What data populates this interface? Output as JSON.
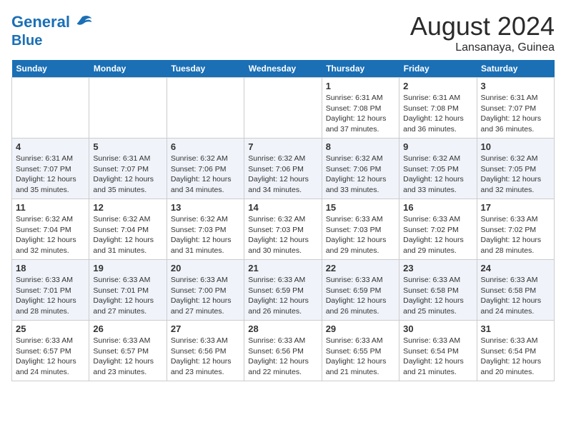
{
  "logo": {
    "line1": "General",
    "line2": "Blue"
  },
  "title": "August 2024",
  "location": "Lansanaya, Guinea",
  "days_of_week": [
    "Sunday",
    "Monday",
    "Tuesday",
    "Wednesday",
    "Thursday",
    "Friday",
    "Saturday"
  ],
  "weeks": [
    [
      {
        "day": "",
        "info": ""
      },
      {
        "day": "",
        "info": ""
      },
      {
        "day": "",
        "info": ""
      },
      {
        "day": "",
        "info": ""
      },
      {
        "day": "1",
        "info": "Sunrise: 6:31 AM\nSunset: 7:08 PM\nDaylight: 12 hours\nand 37 minutes."
      },
      {
        "day": "2",
        "info": "Sunrise: 6:31 AM\nSunset: 7:08 PM\nDaylight: 12 hours\nand 36 minutes."
      },
      {
        "day": "3",
        "info": "Sunrise: 6:31 AM\nSunset: 7:07 PM\nDaylight: 12 hours\nand 36 minutes."
      }
    ],
    [
      {
        "day": "4",
        "info": "Sunrise: 6:31 AM\nSunset: 7:07 PM\nDaylight: 12 hours\nand 35 minutes."
      },
      {
        "day": "5",
        "info": "Sunrise: 6:31 AM\nSunset: 7:07 PM\nDaylight: 12 hours\nand 35 minutes."
      },
      {
        "day": "6",
        "info": "Sunrise: 6:32 AM\nSunset: 7:06 PM\nDaylight: 12 hours\nand 34 minutes."
      },
      {
        "day": "7",
        "info": "Sunrise: 6:32 AM\nSunset: 7:06 PM\nDaylight: 12 hours\nand 34 minutes."
      },
      {
        "day": "8",
        "info": "Sunrise: 6:32 AM\nSunset: 7:06 PM\nDaylight: 12 hours\nand 33 minutes."
      },
      {
        "day": "9",
        "info": "Sunrise: 6:32 AM\nSunset: 7:05 PM\nDaylight: 12 hours\nand 33 minutes."
      },
      {
        "day": "10",
        "info": "Sunrise: 6:32 AM\nSunset: 7:05 PM\nDaylight: 12 hours\nand 32 minutes."
      }
    ],
    [
      {
        "day": "11",
        "info": "Sunrise: 6:32 AM\nSunset: 7:04 PM\nDaylight: 12 hours\nand 32 minutes."
      },
      {
        "day": "12",
        "info": "Sunrise: 6:32 AM\nSunset: 7:04 PM\nDaylight: 12 hours\nand 31 minutes."
      },
      {
        "day": "13",
        "info": "Sunrise: 6:32 AM\nSunset: 7:03 PM\nDaylight: 12 hours\nand 31 minutes."
      },
      {
        "day": "14",
        "info": "Sunrise: 6:32 AM\nSunset: 7:03 PM\nDaylight: 12 hours\nand 30 minutes."
      },
      {
        "day": "15",
        "info": "Sunrise: 6:33 AM\nSunset: 7:03 PM\nDaylight: 12 hours\nand 29 minutes."
      },
      {
        "day": "16",
        "info": "Sunrise: 6:33 AM\nSunset: 7:02 PM\nDaylight: 12 hours\nand 29 minutes."
      },
      {
        "day": "17",
        "info": "Sunrise: 6:33 AM\nSunset: 7:02 PM\nDaylight: 12 hours\nand 28 minutes."
      }
    ],
    [
      {
        "day": "18",
        "info": "Sunrise: 6:33 AM\nSunset: 7:01 PM\nDaylight: 12 hours\nand 28 minutes."
      },
      {
        "day": "19",
        "info": "Sunrise: 6:33 AM\nSunset: 7:01 PM\nDaylight: 12 hours\nand 27 minutes."
      },
      {
        "day": "20",
        "info": "Sunrise: 6:33 AM\nSunset: 7:00 PM\nDaylight: 12 hours\nand 27 minutes."
      },
      {
        "day": "21",
        "info": "Sunrise: 6:33 AM\nSunset: 6:59 PM\nDaylight: 12 hours\nand 26 minutes."
      },
      {
        "day": "22",
        "info": "Sunrise: 6:33 AM\nSunset: 6:59 PM\nDaylight: 12 hours\nand 26 minutes."
      },
      {
        "day": "23",
        "info": "Sunrise: 6:33 AM\nSunset: 6:58 PM\nDaylight: 12 hours\nand 25 minutes."
      },
      {
        "day": "24",
        "info": "Sunrise: 6:33 AM\nSunset: 6:58 PM\nDaylight: 12 hours\nand 24 minutes."
      }
    ],
    [
      {
        "day": "25",
        "info": "Sunrise: 6:33 AM\nSunset: 6:57 PM\nDaylight: 12 hours\nand 24 minutes."
      },
      {
        "day": "26",
        "info": "Sunrise: 6:33 AM\nSunset: 6:57 PM\nDaylight: 12 hours\nand 23 minutes."
      },
      {
        "day": "27",
        "info": "Sunrise: 6:33 AM\nSunset: 6:56 PM\nDaylight: 12 hours\nand 23 minutes."
      },
      {
        "day": "28",
        "info": "Sunrise: 6:33 AM\nSunset: 6:56 PM\nDaylight: 12 hours\nand 22 minutes."
      },
      {
        "day": "29",
        "info": "Sunrise: 6:33 AM\nSunset: 6:55 PM\nDaylight: 12 hours\nand 21 minutes."
      },
      {
        "day": "30",
        "info": "Sunrise: 6:33 AM\nSunset: 6:54 PM\nDaylight: 12 hours\nand 21 minutes."
      },
      {
        "day": "31",
        "info": "Sunrise: 6:33 AM\nSunset: 6:54 PM\nDaylight: 12 hours\nand 20 minutes."
      }
    ]
  ]
}
